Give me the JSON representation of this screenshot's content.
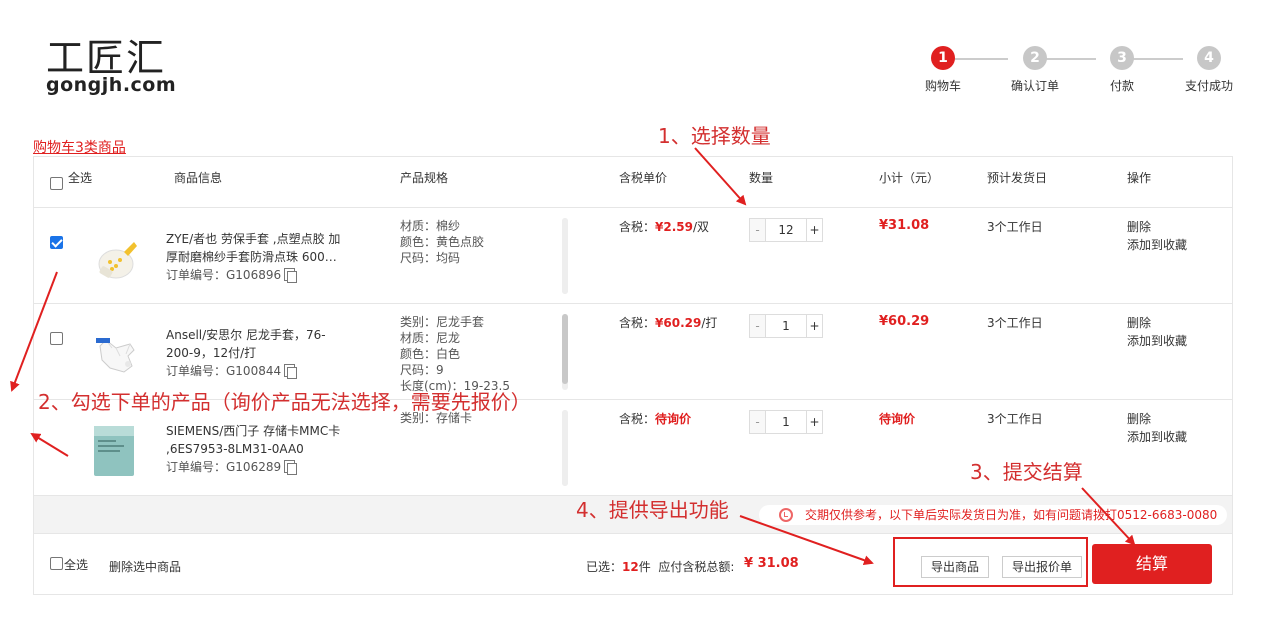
{
  "logo": {
    "cn": "工匠汇",
    "en": "gongjh.com"
  },
  "steps": [
    {
      "num": "1",
      "label": "购物车",
      "active": true
    },
    {
      "num": "2",
      "label": "确认订单",
      "active": false
    },
    {
      "num": "3",
      "label": "付款",
      "active": false
    },
    {
      "num": "4",
      "label": "支付成功",
      "active": false
    }
  ],
  "cart_count": "购物车3类商品",
  "table": {
    "headers": {
      "select_all": "全选",
      "info": "商品信息",
      "spec": "产品规格",
      "unit_price": "含税单价",
      "quantity": "数量",
      "subtotal": "小计（元）",
      "ship": "预计发货日",
      "ops": "操作"
    },
    "rows": [
      {
        "checked": true,
        "title": "ZYE/者也 劳保手套 ,点塑点胶 加厚耐磨棉纱手套防滑点珠 600…",
        "order_id": "订单编号：G106896",
        "spec": [
          "材质：棉纱",
          "颜色：黄色点胶",
          "尺码：均码"
        ],
        "price_prefix": "含税：",
        "price": "¥2.59",
        "price_unit": "/双",
        "qty": "12",
        "subtotal": "¥31.08",
        "ship": "3个工作日",
        "op_delete": "删除",
        "op_fav": "添加到收藏"
      },
      {
        "checked": false,
        "title": "Ansell/安思尔 尼龙手套，76-200-9，12付/打",
        "order_id": "订单编号：G100844",
        "spec": [
          "类别：尼龙手套",
          "材质：尼龙",
          "颜色：白色",
          "尺码：9",
          "长度(cm)：19-23.5"
        ],
        "price_prefix": "含税：",
        "price": "¥60.29",
        "price_unit": "/打",
        "qty": "1",
        "subtotal": "¥60.29",
        "ship": "3个工作日",
        "op_delete": "删除",
        "op_fav": "添加到收藏"
      },
      {
        "checked": false,
        "title": "SIEMENS/西门子 存储卡MMC卡 ,6ES7953-8LM31-0AA0",
        "order_id": "订单编号：G106289",
        "spec": [
          "类别：存储卡"
        ],
        "price_prefix": "含税：",
        "price": "待询价",
        "price_unit": "",
        "qty": "1",
        "subtotal": "待询价",
        "ship": "3个工作日",
        "op_delete": "删除",
        "op_fav": "添加到收藏"
      }
    ],
    "qty_minus": "-",
    "qty_plus": "+"
  },
  "notice": "交期仅供参考，以下单后实际发货日为准，如有问题请拨打0512-6683-0080",
  "footer": {
    "select_all": "全选",
    "delete_selected": "删除选中商品",
    "selected_prefix": "已选：",
    "selected_count": "12",
    "selected_suffix": "件",
    "total_label": "应付含税总额:",
    "total_value": "¥ 31.08",
    "export_goods": "导出商品",
    "export_quote": "导出报价单",
    "checkout": "结算"
  },
  "annotations": {
    "a1": "1、选择数量",
    "a2": "2、勾选下单的产品（询价产品无法选择，需要先报价）",
    "a3": "3、提交结算",
    "a4": "4、提供导出功能"
  },
  "colors": {
    "accent": "#e02020",
    "annotation": "#d32f2f"
  }
}
